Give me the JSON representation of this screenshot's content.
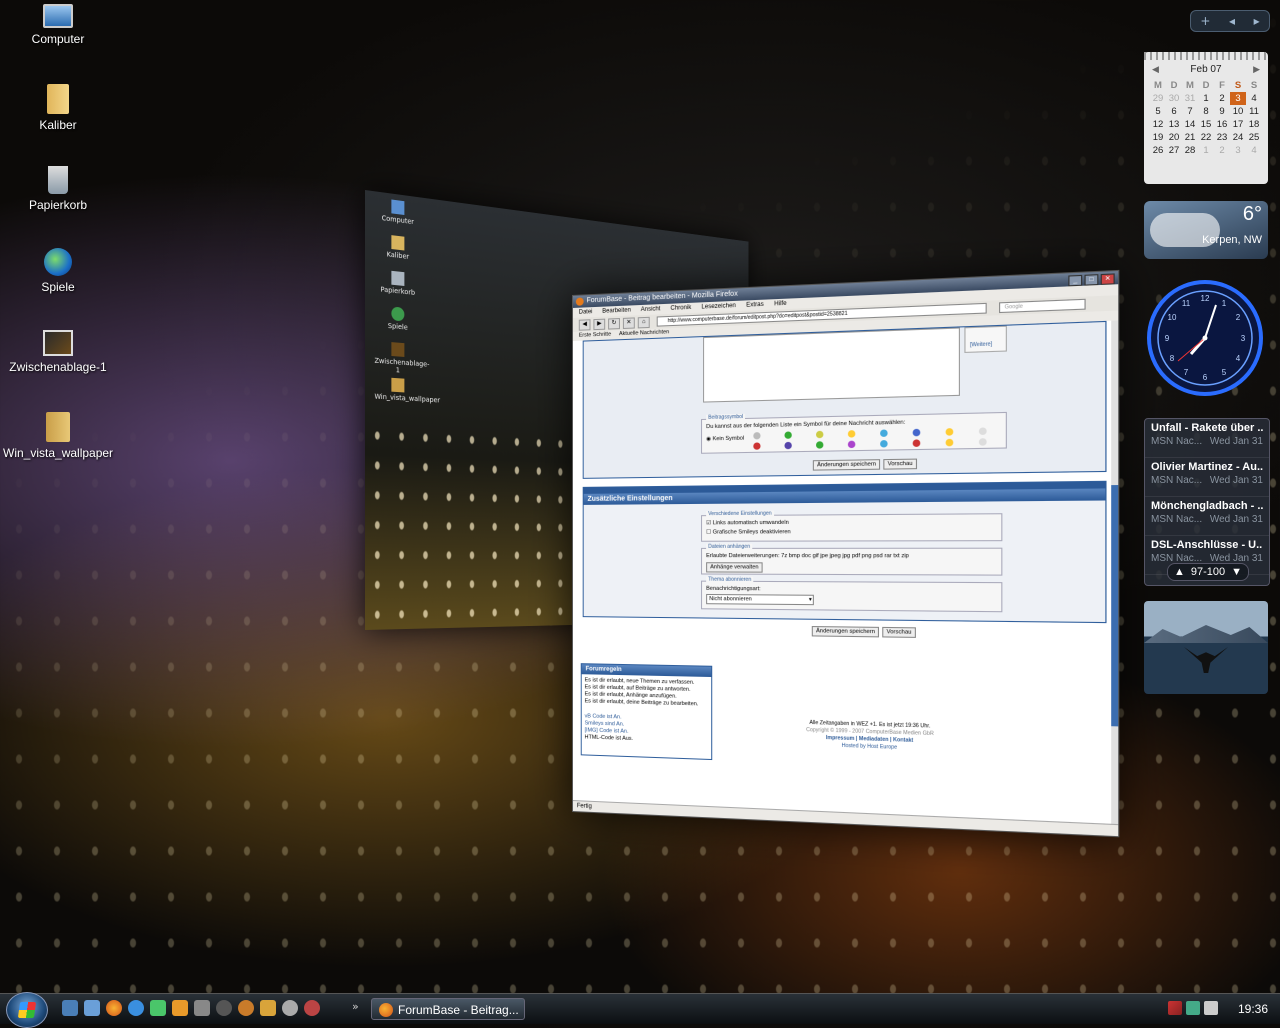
{
  "desktop": {
    "icons": [
      {
        "label": "Computer",
        "icon": "computer-icon"
      },
      {
        "label": "Kaliber",
        "icon": "folder-icon"
      },
      {
        "label": "Papierkorb",
        "icon": "recycle-bin-icon"
      },
      {
        "label": "Spiele",
        "icon": "games-icon"
      },
      {
        "label": "Zwischenablage-1",
        "icon": "image-file-icon"
      },
      {
        "label": "Win_vista_wallpaper",
        "icon": "folder-icon"
      }
    ]
  },
  "back_window": {
    "icons": [
      "Computer",
      "Kaliber",
      "Papierkorb",
      "Spiele",
      "Zwischenablage-1",
      "Win_vista_wallpaper"
    ]
  },
  "firefox": {
    "title": "ForumBase - Beitrag bearbeiten - Mozilla Firefox",
    "menu": [
      "Datei",
      "Bearbeiten",
      "Ansicht",
      "Chronik",
      "Lesezeichen",
      "Extras",
      "Hilfe"
    ],
    "url": "http://www.computerbase.de/forum/editpost.php?do=editpost&postid=2538821",
    "search_placeholder": "Google",
    "bookmarks": [
      "Erste Schritte",
      "Aktuelle Nachrichten"
    ],
    "more_link": "[Weitere]",
    "beitragssymbol": {
      "legend": "Beitragssymbol",
      "text": "Du kannst aus der folgenden Liste ein Symbol für deine Nachricht auswählen:",
      "none_label": "Kein Symbol"
    },
    "buttons": {
      "save": "Änderungen speichern",
      "preview": "Vorschau"
    },
    "zusatz": {
      "title": "Zusätzliche Einstellungen",
      "misc_legend": "Verschiedene Einstellungen",
      "opt1": "Links automatisch umwandeln",
      "opt2": "Grafische Smileys deaktivieren",
      "attach_legend": "Dateien anhängen",
      "attach_text": "Erlaubte Dateierweiterungen: 7z bmp doc gif jpe jpeg jpg pdf png psd rar txt zip",
      "attach_button": "Anhänge verwalten",
      "subscribe_legend": "Thema abonnieren",
      "subscribe_label": "Benachrichtigungsart:",
      "subscribe_value": "Nicht abonnieren"
    },
    "rules": {
      "title": "Forumregeln",
      "lines": [
        "Es ist dir erlaubt, neue Themen zu verfassen.",
        "Es ist dir erlaubt, auf Beiträge zu antworten.",
        "Es ist dir erlaubt, Anhänge anzufügen.",
        "Es ist dir erlaubt, deine Beiträge zu bearbeiten."
      ],
      "codes": [
        "vB Code ist An.",
        "Smileys sind An.",
        "[IMG] Code ist An.",
        "HTML-Code ist Aus."
      ]
    },
    "footer": {
      "time": "Alle Zeitangaben in WEZ +1. Es ist jetzt 19:36 Uhr.",
      "copyright": "Copyright © 1999 - 2007 ComputerBase Medien GbR",
      "links": "Impressum | Mediadaten | Kontakt",
      "hosted": "Hosted by Host Europe"
    },
    "status": "Fertig"
  },
  "sidebar": {
    "calendar": {
      "month": "Feb 07",
      "weekdays": [
        "M",
        "D",
        "M",
        "D",
        "F",
        "S",
        "S"
      ],
      "weeks": [
        [
          "29",
          "30",
          "31",
          "1",
          "2",
          "3",
          "4"
        ],
        [
          "5",
          "6",
          "7",
          "8",
          "9",
          "10",
          "11"
        ],
        [
          "12",
          "13",
          "14",
          "15",
          "16",
          "17",
          "18"
        ],
        [
          "19",
          "20",
          "21",
          "22",
          "23",
          "24",
          "25"
        ],
        [
          "26",
          "27",
          "28",
          "1",
          "2",
          "3",
          "4"
        ]
      ],
      "today": "3"
    },
    "weather": {
      "temp": "6°",
      "location": "Kerpen, NW"
    },
    "news": {
      "items": [
        {
          "title": "Unfall - Rakete über ...",
          "source": "MSN Nac...",
          "date": "Wed Jan 31"
        },
        {
          "title": "Olivier Martinez - Au...",
          "source": "MSN Nac...",
          "date": "Wed Jan 31"
        },
        {
          "title": "Mönchengladbach - ...",
          "source": "MSN Nac...",
          "date": "Wed Jan 31"
        },
        {
          "title": "DSL-Anschlüsse - U...",
          "source": "MSN Nac...",
          "date": "Wed Jan 31"
        }
      ],
      "pager": "97-100"
    }
  },
  "taskbar": {
    "app_label": "ForumBase - Beitrag...",
    "time": "19:36"
  }
}
